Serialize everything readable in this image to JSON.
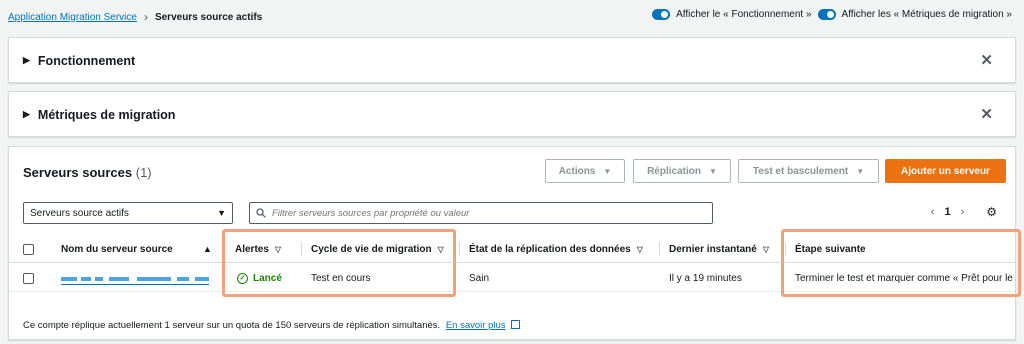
{
  "breadcrumb": {
    "root": "Application Migration Service",
    "current": "Serveurs source actifs"
  },
  "toggles": {
    "show_operational": "Afficher le « Fonctionnement »",
    "show_metrics": "Afficher les « Métriques de migration »"
  },
  "panels": {
    "operational": "Fonctionnement",
    "metrics": "Métriques de migration"
  },
  "sources": {
    "title": "Serveurs sources",
    "count": "(1)",
    "buttons": {
      "actions": "Actions",
      "replication": "Réplication",
      "test_cutover": "Test et basculement",
      "add_server": "Ajouter un serveur"
    },
    "filter_select": "Serveurs source actifs",
    "search_placeholder": "Filtrer serveurs sources par propriété ou valeur",
    "page": "1",
    "columns": {
      "name": "Nom du serveur source",
      "alerts": "Alertes",
      "lifecycle": "Cycle de vie de migration",
      "replication_state": "État de la réplication des données",
      "last_snapshot": "Dernier instantané",
      "next_step": "Étape suivante"
    },
    "rows": [
      {
        "alert": "Lancé",
        "lifecycle": "Test en cours",
        "replication_state": "Sain",
        "last_snapshot": "Il y a 19 minutes",
        "next_step": "Terminer le test et marquer comme « Prêt pour le basculement »"
      }
    ],
    "footer_text": "Ce compte réplique actuellement 1 serveur sur un quota de 150 serveurs de réplication simultanés.",
    "learn_more": "En savoir plus"
  },
  "colors": {
    "accent": "#0073bb",
    "primary_button": "#ec7211",
    "success": "#1d8102",
    "highlight": "#f0a27e"
  }
}
